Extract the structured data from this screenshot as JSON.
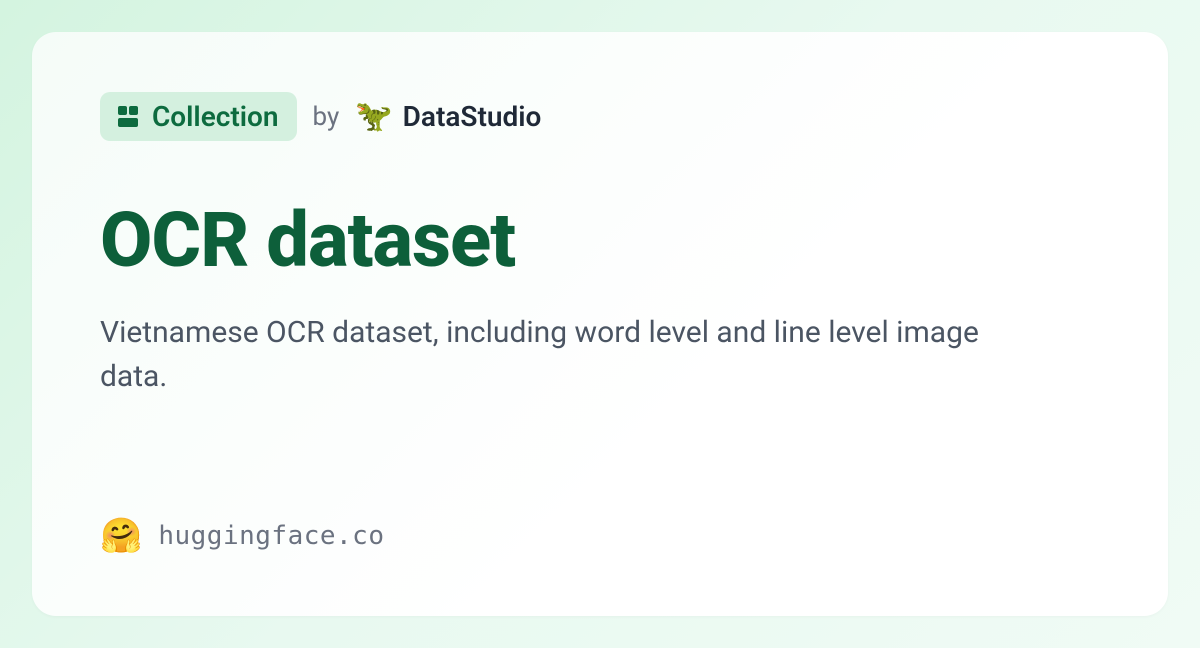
{
  "badge": {
    "label": "Collection"
  },
  "by_label": "by",
  "author": {
    "emoji": "🦖",
    "name": "DataStudio"
  },
  "title": "OCR dataset",
  "description": "Vietnamese OCR dataset, including word level and line level image data.",
  "footer": {
    "emoji": "🤗",
    "domain": "huggingface.co"
  }
}
